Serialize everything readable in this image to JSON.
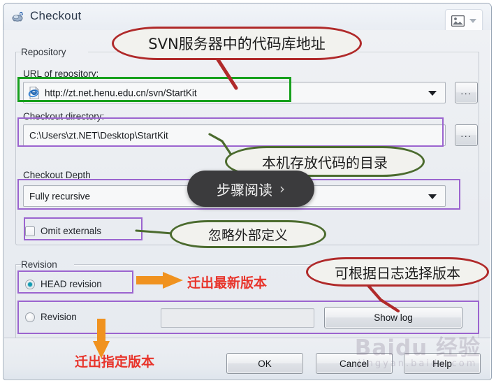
{
  "window": {
    "title": "Checkout",
    "title_icon": "tortoisesvn-checkout-icon",
    "picture_button_icon": "picture-icon",
    "picture_button_chevron": "chevron-down-icon"
  },
  "repository": {
    "group_label": "Repository",
    "url_label": "URL of repository:",
    "url_value": "http://zt.net.henu.edu.cn/svn/StartKit",
    "url_icon": "internet-explorer-icon",
    "url_browse_label": "...",
    "dir_label": "Checkout directory:",
    "dir_value": "C:\\Users\\zt.NET\\Desktop\\StartKit",
    "dir_browse_label": "...",
    "depth_label": "Checkout Depth",
    "depth_value": "Fully recursive",
    "omit_externals_label": "Omit externals",
    "omit_externals_checked": false
  },
  "revision": {
    "group_label": "Revision",
    "head_label": "HEAD revision",
    "head_selected": true,
    "rev_label": "Revision",
    "rev_selected": false,
    "rev_value": "",
    "show_log_label": "Show log"
  },
  "buttons": {
    "ok": "OK",
    "cancel": "Cancel",
    "help": "Help"
  },
  "annotations": {
    "url_note": "SVN服务器中的代码库地址",
    "dir_note": "本机存放代码的目录",
    "omit_note": "忽略外部定义",
    "head_note": "迁出最新版本",
    "showlog_note": "可根据日志选择版本",
    "revision_note": "迁出指定版本",
    "step_pill": "步骤阅读",
    "step_pill_chevron": "›"
  },
  "watermark": {
    "line1": "Baidu 经验",
    "line2": "jingyan.baidu.com"
  },
  "colors": {
    "red_annotation": "#b02a2a",
    "green_annotation": "#4b6b2e",
    "purple_highlight": "#9b64cf",
    "green_highlight": "#17a01d",
    "orange_arrow": "#f0921f",
    "red_text": "#e8342b",
    "radio_accent": "#119bb3"
  }
}
